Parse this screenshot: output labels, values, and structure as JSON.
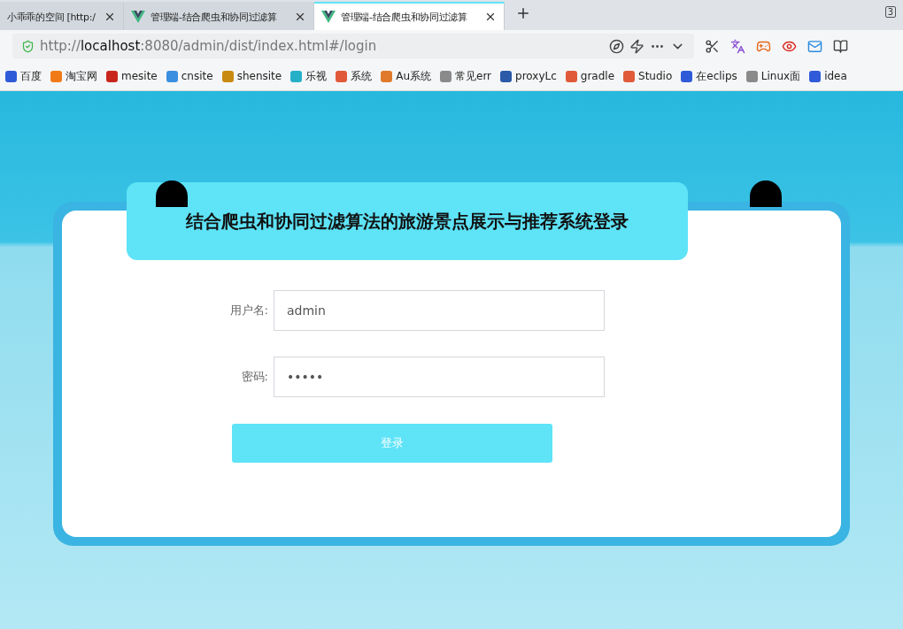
{
  "tabs": [
    {
      "title": "小乖乖的空间 [http:/",
      "kind": "plain",
      "selected": false
    },
    {
      "title": "管理端-结合爬虫和协同过滤算",
      "kind": "vue",
      "selected": false
    },
    {
      "title": "管理端-结合爬虫和协同过滤算",
      "kind": "vue",
      "selected": true
    }
  ],
  "tab_count": "3",
  "address_bar": {
    "scheme": "http://",
    "host": "localhost",
    "rest": ":8080/admin/dist/index.html#/login"
  },
  "bookmarks": [
    {
      "label": "百度",
      "color": "#2f5bd9"
    },
    {
      "label": "淘宝网",
      "color": "#f07b16"
    },
    {
      "label": "mesite",
      "color": "#c8261c"
    },
    {
      "label": "cnsite",
      "color": "#3a8fe0"
    },
    {
      "label": "shensite",
      "color": "#c98a12"
    },
    {
      "label": "乐视",
      "color": "#25b0c8"
    },
    {
      "label": "系统",
      "color": "#e05a3a"
    },
    {
      "label": "Au系统",
      "color": "#e07a2a"
    },
    {
      "label": "常见err",
      "color": "#8a8a8a"
    },
    {
      "label": "proxyLc",
      "color": "#2a5aa8"
    },
    {
      "label": "gradle",
      "color": "#e05a3a"
    },
    {
      "label": "Studio",
      "color": "#e05a3a"
    },
    {
      "label": "在eclips",
      "color": "#2f5bd9"
    },
    {
      "label": "Linux面",
      "color": "#8a8a8a"
    },
    {
      "label": "idea",
      "color": "#2f5bd9"
    }
  ],
  "login": {
    "title": "结合爬虫和协同过滤算法的旅游景点展示与推荐系统登录",
    "fields": [
      {
        "label": "用户名:",
        "value": "admin"
      },
      {
        "label": "密码:",
        "value": "•••••"
      }
    ],
    "button": "登录"
  }
}
